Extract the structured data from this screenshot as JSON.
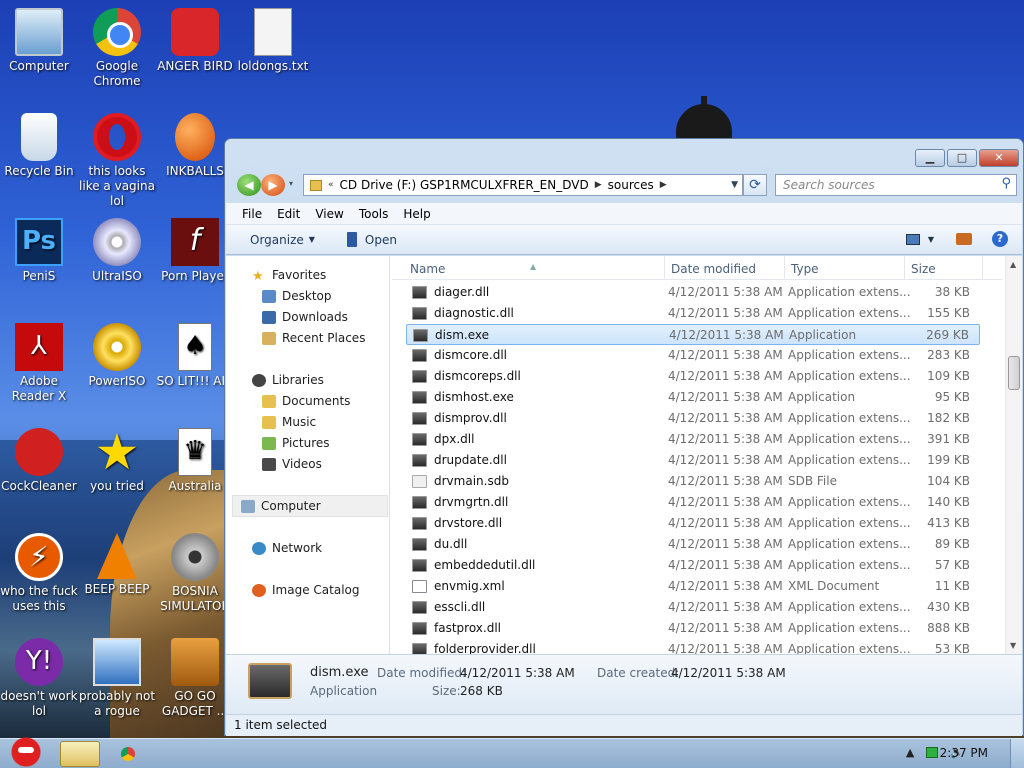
{
  "desktop": {
    "icons": [
      {
        "label": "Computer",
        "icon": "computer-icon"
      },
      {
        "label": "Google Chrome",
        "icon": "chrome-icon"
      },
      {
        "label": "ANGER BIRD",
        "icon": "angry-bird-icon"
      },
      {
        "label": "loldongs.txt",
        "icon": "text-file-icon"
      },
      {
        "label": "Recycle Bin",
        "icon": "recycle-bin-icon"
      },
      {
        "label": "this looks like a vagina lol",
        "icon": "opera-icon"
      },
      {
        "label": "INKBALLS",
        "icon": "inkball-icon"
      },
      {
        "label": "PeniS",
        "icon": "photoshop-icon"
      },
      {
        "label": "UltraISO",
        "icon": "disc-icon"
      },
      {
        "label": "Porn Player",
        "icon": "flash-icon"
      },
      {
        "label": "Adobe Reader X",
        "icon": "pdf-icon"
      },
      {
        "label": "PowerISO",
        "icon": "gold-disc-icon"
      },
      {
        "label": "SO LIT!!! AIR",
        "icon": "card-icon"
      },
      {
        "label": "CockCleaner",
        "icon": "ccleaner-icon"
      },
      {
        "label": "you tried",
        "icon": "star-icon"
      },
      {
        "label": "Australia",
        "icon": "australia-icon"
      },
      {
        "label": "who the fuck uses this",
        "icon": "bolt-icon"
      },
      {
        "label": "BEEP BEEP",
        "icon": "vlc-cone-icon"
      },
      {
        "label": "BOSNIA SIMULATOR",
        "icon": "gear-icon"
      },
      {
        "label": "doesn't work lol",
        "icon": "yahoo-icon"
      },
      {
        "label": "probably not a rogue",
        "icon": "monitor-icon"
      },
      {
        "label": "GO GO GADGET ...",
        "icon": "bag-icon"
      }
    ]
  },
  "window": {
    "address": {
      "prefix": "«",
      "crumbs": [
        "CD Drive (F:) GSP1RMCULXFRER_EN_DVD",
        "sources"
      ]
    },
    "search_placeholder": "Search sources",
    "menu": [
      "File",
      "Edit",
      "View",
      "Tools",
      "Help"
    ],
    "toolbar": {
      "organize": "Organize",
      "open": "Open"
    },
    "nav": {
      "favorites": "Favorites",
      "desktop": "Desktop",
      "downloads": "Downloads",
      "recent": "Recent Places",
      "libraries": "Libraries",
      "documents": "Documents",
      "music": "Music",
      "pictures": "Pictures",
      "videos": "Videos",
      "computer": "Computer",
      "network": "Network",
      "image_catalog": "Image Catalog"
    },
    "columns": {
      "name": "Name",
      "date": "Date modified",
      "type": "Type",
      "size": "Size"
    },
    "files": [
      {
        "name": "diager.dll",
        "date": "4/12/2011 5:38 AM",
        "type": "Application extens...",
        "size": "38 KB",
        "kind": "dll"
      },
      {
        "name": "diagnostic.dll",
        "date": "4/12/2011 5:38 AM",
        "type": "Application extens...",
        "size": "155 KB",
        "kind": "dll"
      },
      {
        "name": "dism.exe",
        "date": "4/12/2011 5:38 AM",
        "type": "Application",
        "size": "269 KB",
        "kind": "exe",
        "selected": true
      },
      {
        "name": "dismcore.dll",
        "date": "4/12/2011 5:38 AM",
        "type": "Application extens...",
        "size": "283 KB",
        "kind": "dll"
      },
      {
        "name": "dismcoreps.dll",
        "date": "4/12/2011 5:38 AM",
        "type": "Application extens...",
        "size": "109 KB",
        "kind": "dll"
      },
      {
        "name": "dismhost.exe",
        "date": "4/12/2011 5:38 AM",
        "type": "Application",
        "size": "95 KB",
        "kind": "exe"
      },
      {
        "name": "dismprov.dll",
        "date": "4/12/2011 5:38 AM",
        "type": "Application extens...",
        "size": "182 KB",
        "kind": "dll"
      },
      {
        "name": "dpx.dll",
        "date": "4/12/2011 5:38 AM",
        "type": "Application extens...",
        "size": "391 KB",
        "kind": "dll"
      },
      {
        "name": "drupdate.dll",
        "date": "4/12/2011 5:38 AM",
        "type": "Application extens...",
        "size": "199 KB",
        "kind": "dll"
      },
      {
        "name": "drvmain.sdb",
        "date": "4/12/2011 5:38 AM",
        "type": "SDB File",
        "size": "104 KB",
        "kind": "sdb"
      },
      {
        "name": "drvmgrtn.dll",
        "date": "4/12/2011 5:38 AM",
        "type": "Application extens...",
        "size": "140 KB",
        "kind": "dll"
      },
      {
        "name": "drvstore.dll",
        "date": "4/12/2011 5:38 AM",
        "type": "Application extens...",
        "size": "413 KB",
        "kind": "dll"
      },
      {
        "name": "du.dll",
        "date": "4/12/2011 5:38 AM",
        "type": "Application extens...",
        "size": "89 KB",
        "kind": "dll"
      },
      {
        "name": "embeddedutil.dll",
        "date": "4/12/2011 5:38 AM",
        "type": "Application extens...",
        "size": "57 KB",
        "kind": "dll"
      },
      {
        "name": "envmig.xml",
        "date": "4/12/2011 5:38 AM",
        "type": "XML Document",
        "size": "11 KB",
        "kind": "xml"
      },
      {
        "name": "esscli.dll",
        "date": "4/12/2011 5:38 AM",
        "type": "Application extens...",
        "size": "430 KB",
        "kind": "dll"
      },
      {
        "name": "fastprox.dll",
        "date": "4/12/2011 5:38 AM",
        "type": "Application extens...",
        "size": "888 KB",
        "kind": "dll"
      },
      {
        "name": "folderprovider.dll",
        "date": "4/12/2011 5:38 AM",
        "type": "Application extens...",
        "size": "53 KB",
        "kind": "dll"
      }
    ],
    "details": {
      "name": "dism.exe",
      "type": "Application",
      "date_modified_label": "Date modified:",
      "date_modified": "4/12/2011 5:38 AM",
      "size_label": "Size:",
      "size": "268 KB",
      "date_created_label": "Date created:",
      "date_created": "4/12/2011 5:38 AM"
    },
    "status": "1 item selected"
  },
  "taskbar": {
    "clock": "2:37 PM"
  }
}
